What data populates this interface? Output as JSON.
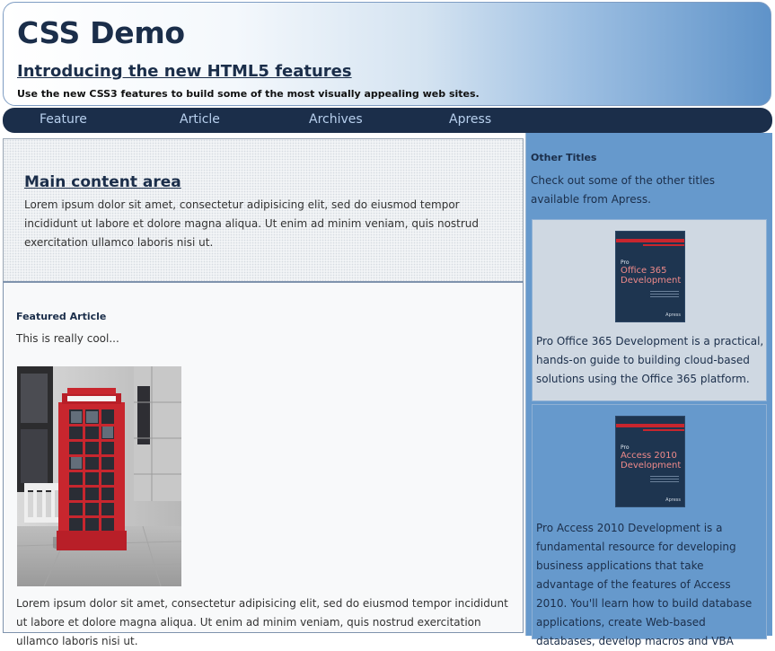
{
  "header": {
    "title": "CSS Demo",
    "subtitle": "Introducing the new HTML5 features",
    "tagline": "Use the new CSS3 features to build some of the most visually appealing web sites."
  },
  "nav": {
    "items": [
      "Feature",
      "Article",
      "Archives",
      "Apress"
    ]
  },
  "main": {
    "heading": "Main content area",
    "text": "Lorem ipsum dolor sit amet, consectetur adipisicing elit, sed do eiusmod tempor incididunt ut labore et dolore magna aliqua. Ut enim ad minim veniam, quis nostrud exercitation ullamco laboris nisi ut."
  },
  "article": {
    "heading": "Featured Article",
    "subtitle": "This is really cool...",
    "image_alt": "Red telephone box",
    "body": "Lorem ipsum dolor sit amet, consectetur adipisicing elit, sed do eiusmod tempor incididunt ut labore et dolore magna aliqua. Ut enim ad minim veniam, quis nostrud exercitation ullamco laboris nisi ut."
  },
  "aside": {
    "heading": "Other Titles",
    "intro": "Check out some of the other titles available from Apress.",
    "books": [
      {
        "cover_prefix": "Pro",
        "cover_title": "Office 365 Development",
        "publisher": "Apress",
        "description": "Pro Office 365 Development is a practical, hands-on guide to building cloud-based solutions using the Office 365 platform."
      },
      {
        "cover_prefix": "Pro",
        "cover_title": "Access 2010 Development",
        "publisher": "Apress",
        "description": "Pro Access 2010 Development is a fundamental resource for developing business applications that take advantage of the features of Access 2010. You'll learn how to build database applications, create Web-based databases, develop macros and VBA"
      }
    ]
  },
  "colors": {
    "navy": "#1b2e4a",
    "nav_link": "#b8d0ee",
    "aside_bg": "#6699cc",
    "phone_red": "#c8262e"
  }
}
